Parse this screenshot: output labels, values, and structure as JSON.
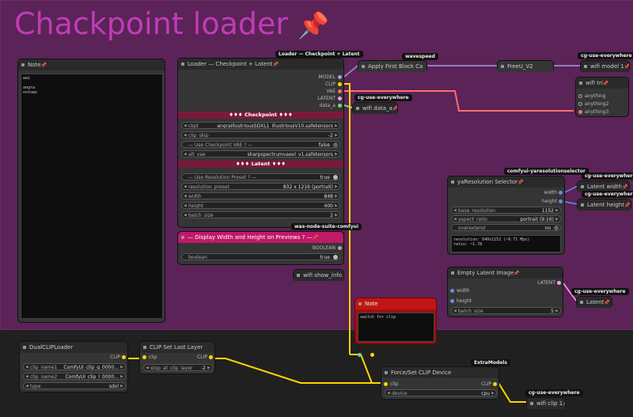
{
  "title": "Chackpoint loader",
  "colors": {
    "clip": "#ffd500",
    "vae": "#ff6e6e",
    "model": "#b39ddb",
    "latent": "#ff9cf9",
    "data": "#7dd67d"
  },
  "note_node": {
    "title": "Note",
    "text": "wai\n\nangra\nnotowo"
  },
  "loader": {
    "badge": "Loader — Checkpoint + Latent",
    "title": "Loader — Checkpoint + Latent",
    "outputs": [
      "MODEL",
      "CLIP",
      "VAE",
      "LATENT",
      "data_a"
    ],
    "section_checkpoint": "♦♦♦ Checkpoint ♦♦♦",
    "ckpt_label": "ckpt",
    "ckpt_value": "angraIllustriousSDXL1_illustriousV10.safetensors",
    "clip_skip_label": "clip_skip",
    "clip_skip_value": "-2",
    "use_ckpt_vae_label": "— Use Checkpoint VAE ? —",
    "use_ckpt_vae_value": "false",
    "alt_vae_label": "alt_vae",
    "alt_vae_value": "sharpspectrumvaexl_v1.safetensors",
    "section_latent": "♦♦♦ Latent ♦♦♦",
    "use_res_label": "— Use Resolution Preset ? —",
    "use_res_value": "true",
    "res_preset_label": "resolution_preset",
    "res_preset_value": "832 x 1216  (portrait)",
    "width_label": "width",
    "width_value": "848",
    "height_label": "height",
    "height_value": "400",
    "batch_label": "batch_size",
    "batch_value": "2"
  },
  "display_node": {
    "badge": "was-node-suite-comfyui",
    "title": "— Display Width and Height on Previews ? —",
    "out": "BOOLEAN",
    "widget_label": "boolean",
    "widget_value": "true"
  },
  "first_block": {
    "badge": "wavespeed",
    "title": "Apply First Block Ca"
  },
  "freeu": {
    "title": "FreeU_V2"
  },
  "wifi_model": {
    "badge": "cg-use-everywhere",
    "title": "wifi model 1"
  },
  "wifi_tri": {
    "title": "wifi tri",
    "inputs": [
      "anything",
      "anything2",
      "anything3"
    ]
  },
  "wifi_data": {
    "badge": "cg-use-everywhere",
    "title": "wifi data_a"
  },
  "wifi_show": {
    "title": "wifi show_info"
  },
  "ya_res": {
    "badge": "comfyui-yaresolutionselector",
    "title": "yaResolution Selector",
    "outputs": [
      "width",
      "height"
    ],
    "base_label": "base_resolution",
    "base_value": "1152",
    "aspect_label": "aspect_ratio",
    "aspect_value": "portrait (9:16)",
    "overextend_label": "overextend",
    "overextend_value": "no",
    "info": "resolution: 640x1152 (~0.71 Mpx)\nratio: ~1.78"
  },
  "latent_width": {
    "badge": "cg-use-everywhere",
    "title": "Latent width"
  },
  "latent_height": {
    "badge": "cg-use-everywhere",
    "title": "Latent height"
  },
  "empty_latent": {
    "title": "Empty Latent Image",
    "output": "LATENT",
    "inputs": [
      "width",
      "height"
    ],
    "batch_label": "batch_size",
    "batch_value": "5"
  },
  "latent_out": {
    "badge": "cg-use-everywhere",
    "title": "Latent"
  },
  "note2": {
    "title": "Note",
    "text": "switch for clip"
  },
  "dual_clip": {
    "title": "DualCLIPLoader",
    "output": "CLIP",
    "clip1_label": "clip_name1",
    "clip1_value": "ComfyUI_clip_g_0000...",
    "clip2_label": "clip_name2",
    "clip2_value": "ComfyUI_clip_l_0000...",
    "type_label": "type",
    "type_value": "sdxl"
  },
  "clip_last": {
    "title": "CLIP Set Last Layer",
    "input": "clip",
    "output": "CLIP",
    "widget_label": "stop_at_clip_layer",
    "widget_value": "-2"
  },
  "force_clip": {
    "badge": "ExtraModels",
    "title": "Force/Set CLIP Device",
    "input": "clip",
    "output": "CLIP",
    "device_label": "device",
    "device_value": "cpu"
  },
  "wifi_clip": {
    "badge": "cg-use-everywhere",
    "title": "wifi clip 1"
  }
}
